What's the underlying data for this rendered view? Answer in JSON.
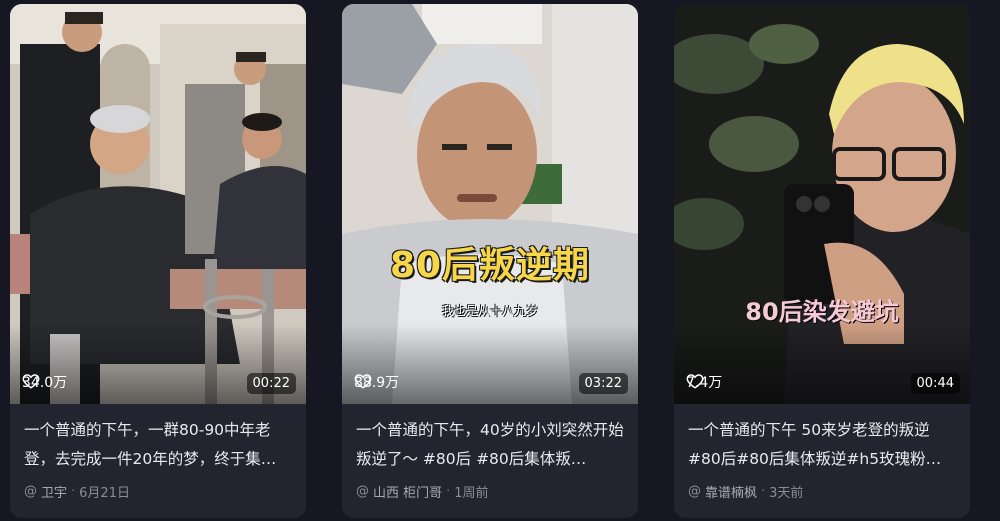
{
  "cards": [
    {
      "likes": "34.0万",
      "duration": "00:22",
      "title": "一个普通的下午，一群80-90中年老登，去完成一件20年的梦，终于集…",
      "author_prefix": "@",
      "author": "卫宇",
      "date": "6月21日"
    },
    {
      "likes": "88.9万",
      "duration": "03:22",
      "overlay_big": "80后叛逆期",
      "overlay_small": "我也是从十八九岁",
      "title": "一个普通的下午，40岁的小刘突然开始叛逆了～ #80后 #80后集体叛…",
      "author_prefix": "@",
      "author": "山西 柜门哥",
      "date": "1周前"
    },
    {
      "likes": "7.4万",
      "duration": "00:44",
      "overlay_pink": "80后染发避坑",
      "title": "一个普通的下午 50来岁老登的叛逆 #80后#80后集体叛逆#h5玫瑰粉…",
      "author_prefix": "@",
      "author": "靠谱楠枫",
      "date": "3天前"
    }
  ],
  "colors": {
    "page_bg": "#161722",
    "card_bg": "#23242f",
    "overlay_yellow": "#f7d64a",
    "overlay_pink": "#f6c9d6",
    "meta_text": "#8b8c98"
  }
}
